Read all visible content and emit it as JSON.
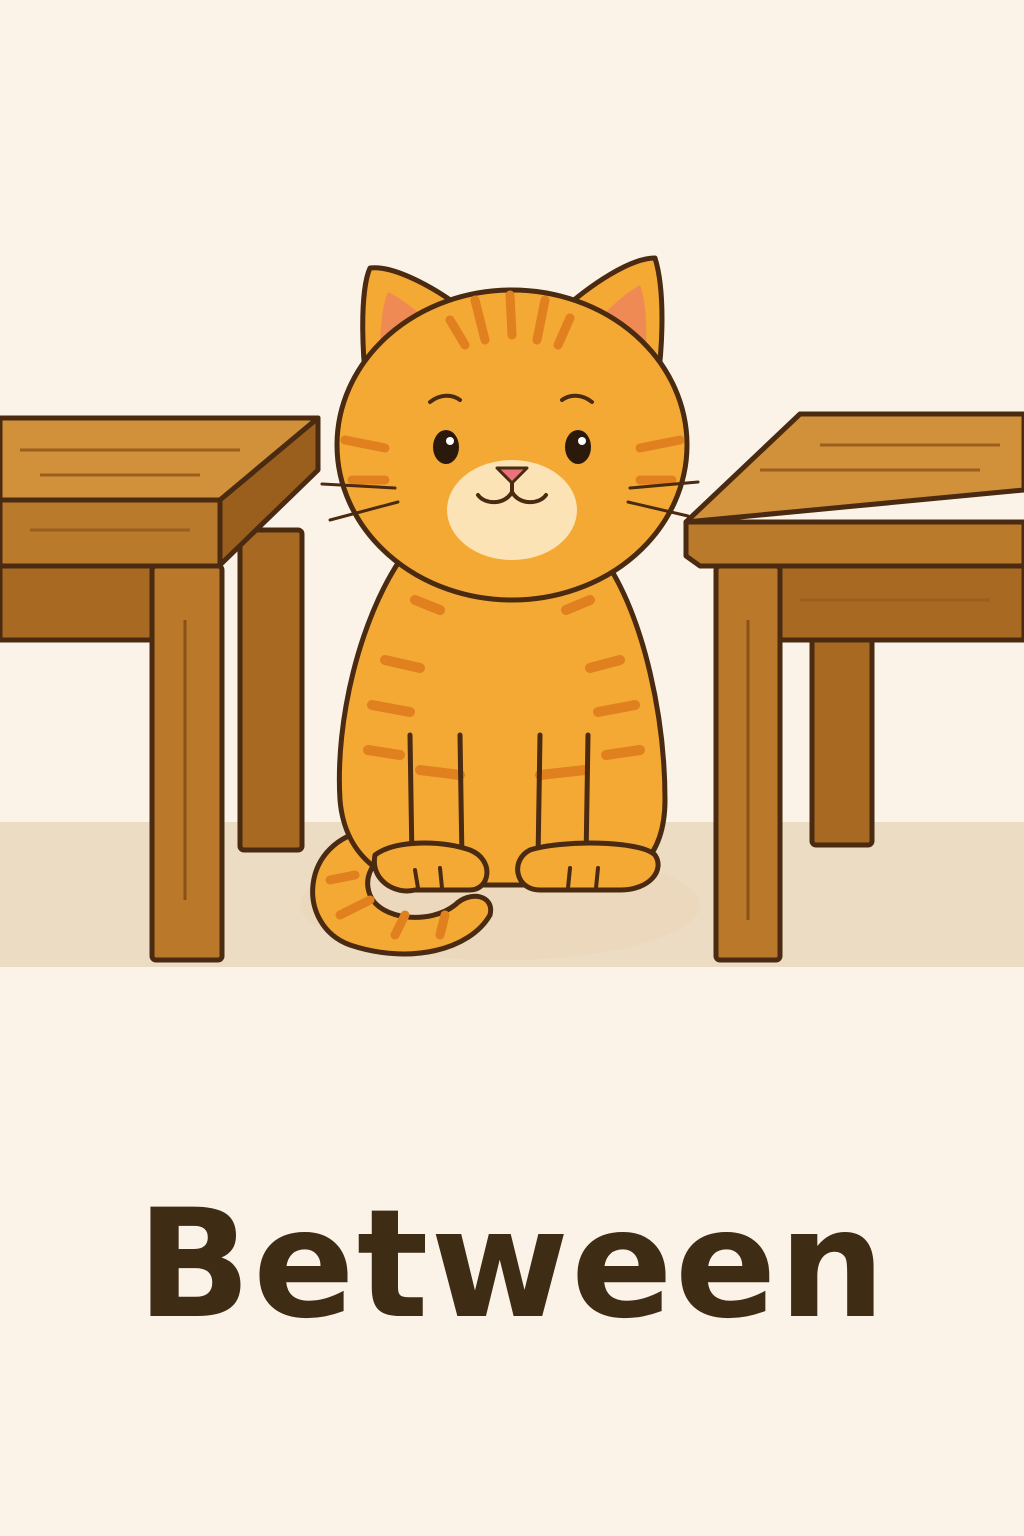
{
  "card": {
    "word": "Between"
  },
  "illustration": {
    "subject": "orange-tabby-cat",
    "left_object": "wooden-table",
    "right_object": "wooden-table"
  },
  "colors": {
    "background": "#fbf3e8",
    "floor_shadow": "#ecdcc3",
    "wood_top": "#c98a34",
    "wood_side": "#a86a22",
    "wood_leg": "#b9782a",
    "cat_fur": "#f4a934",
    "cat_stripe": "#e0801e",
    "cat_muzzle": "#fbe3b5",
    "outline": "#4a2a10",
    "text": "#3f2c14"
  }
}
